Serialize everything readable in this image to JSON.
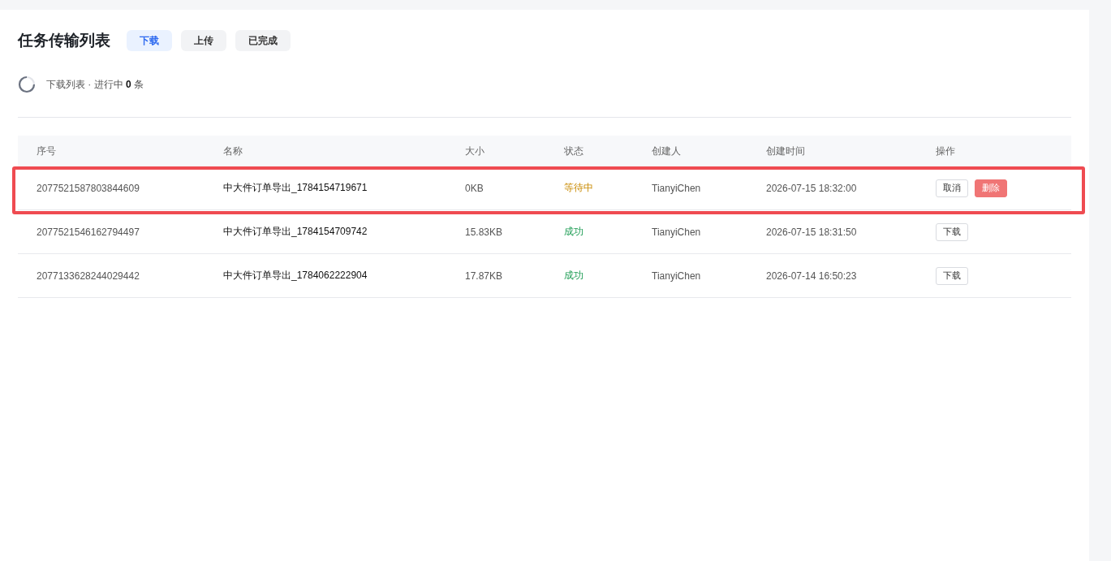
{
  "title": "任务传输列表",
  "tabs": [
    {
      "label": "下载",
      "selected": true
    },
    {
      "label": "上传",
      "selected": false
    },
    {
      "label": "已完成",
      "selected": false
    }
  ],
  "summary": "下载列表 · 进行中 **0** 条",
  "table": {
    "columns": [
      "序号",
      "名称",
      "大小",
      "状态",
      "创建人",
      "创建时间",
      "操作"
    ],
    "rows": [
      {
        "id": "2077521587803844609",
        "name": "中大件订单导出_1784154719671",
        "size": "0KB",
        "status": {
          "text": "等待中",
          "kind": "waiting"
        },
        "creator": "TianyiChen",
        "created": "2026-07-15 18:32:00",
        "highlighted": true,
        "actions": [
          {
            "label": "取消",
            "kind": "default"
          },
          {
            "label": "删除",
            "kind": "danger"
          }
        ]
      },
      {
        "id": "2077521546162794497",
        "name": "中大件订单导出_1784154709742",
        "size": "15.83KB",
        "status": {
          "text": "成功",
          "kind": "success"
        },
        "creator": "TianyiChen",
        "created": "2026-07-15 18:31:50",
        "highlighted": false,
        "actions": [
          {
            "label": "下载",
            "kind": "default"
          }
        ]
      },
      {
        "id": "2077133628244029442",
        "name": "中大件订单导出_1784062222904",
        "size": "17.87KB",
        "status": {
          "text": "成功",
          "kind": "success"
        },
        "creator": "TianyiChen",
        "created": "2026-07-14 16:50:23",
        "highlighted": false,
        "actions": [
          {
            "label": "下载",
            "kind": "default"
          }
        ]
      }
    ]
  }
}
